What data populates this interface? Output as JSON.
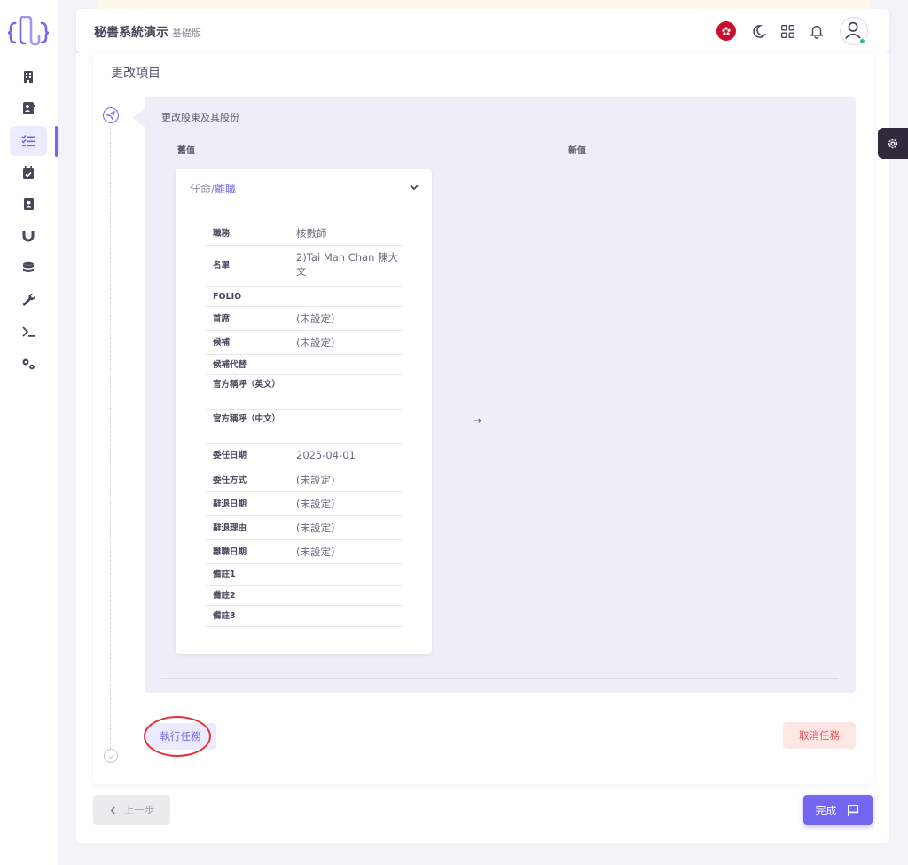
{
  "header": {
    "app_title": "秘書系統演示",
    "edition": "基礎版"
  },
  "sidebar": {
    "items": [
      {
        "icon": "building-icon"
      },
      {
        "icon": "contact-card-icon"
      },
      {
        "icon": "checklist-icon",
        "active": true
      },
      {
        "icon": "calendar-check-icon"
      },
      {
        "icon": "address-book-icon"
      },
      {
        "icon": "magnet-icon"
      },
      {
        "icon": "database-icon"
      },
      {
        "icon": "wrench-icon"
      },
      {
        "icon": "terminal-icon"
      },
      {
        "icon": "cogs-icon"
      }
    ]
  },
  "page": {
    "section_title": "更改項目",
    "change_title": "更改股東及其股份",
    "col_old": "舊值",
    "col_new": "新值",
    "arrow": "→"
  },
  "detail": {
    "head_prefix": "任命/",
    "head_accent": "離職",
    "rows": [
      {
        "key": "職務",
        "value": "核數師"
      },
      {
        "key": "名單",
        "value": "2)Tai Man Chan 陳大文"
      },
      {
        "key": "FOLIO",
        "value": ""
      },
      {
        "key": "首席",
        "value": "(未設定)"
      },
      {
        "key": "候補",
        "value": "(未設定)"
      },
      {
        "key": "候補代替",
        "value": ""
      },
      {
        "key": "官方稱呼（英文）",
        "value": ""
      },
      {
        "key": "官方稱呼（中文）",
        "value": ""
      },
      {
        "key": "委任日期",
        "value": "2025-04-01"
      },
      {
        "key": "委任方式",
        "value": "(未設定)"
      },
      {
        "key": "辭退日期",
        "value": "(未設定)"
      },
      {
        "key": "辭退理由",
        "value": "(未設定)"
      },
      {
        "key": "離職日期",
        "value": "(未設定)"
      },
      {
        "key": "備註1",
        "value": ""
      },
      {
        "key": "備註2",
        "value": ""
      },
      {
        "key": "備註3",
        "value": ""
      }
    ]
  },
  "actions": {
    "execute": "執行任務",
    "cancel": "取消任務",
    "prev": "上一步",
    "done": "完成"
  },
  "colors": {
    "primary": "#7367f0",
    "danger": "#ea5455",
    "success": "#28c76f",
    "annotation": "#e0343a"
  }
}
